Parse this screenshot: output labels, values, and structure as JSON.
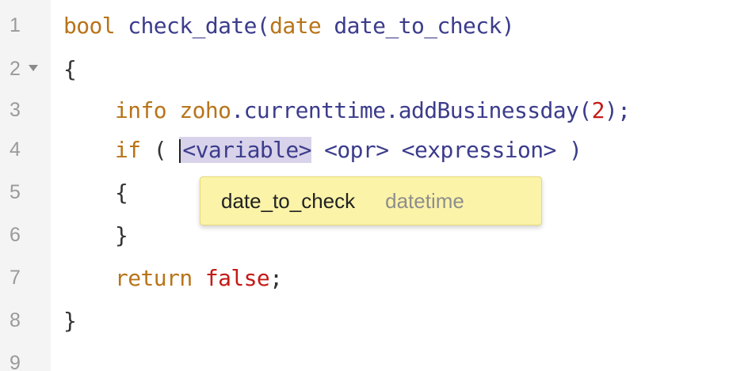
{
  "editor": {
    "lines": [
      {
        "n": "1"
      },
      {
        "n": "2"
      },
      {
        "n": "3"
      },
      {
        "n": "4"
      },
      {
        "n": "5"
      },
      {
        "n": "6"
      },
      {
        "n": "7"
      },
      {
        "n": "8"
      },
      {
        "n": "9"
      }
    ],
    "code": {
      "l1_type": "bool",
      "l1_sig": " check_date(",
      "l1_ptype": "date",
      "l1_pname": " date_to_check)",
      "l2": "{",
      "l3_indent": "    ",
      "l3_info": "info",
      "l3_obj": " zoho",
      "l3_call": ".currenttime.addBusinessday(",
      "l3_num": "2",
      "l3_end": ");",
      "l4_indent": "    ",
      "l4_if": "if",
      "l4_open": " ( ",
      "l4_var": "<variable>",
      "l4_rest": " <opr> <expression> )",
      "l5": "    {",
      "l6": "    }",
      "l7_indent": "    ",
      "l7_return": "return",
      "l7_space": " ",
      "l7_false": "false",
      "l7_semi": ";",
      "l8": "}",
      "l9": ""
    }
  },
  "suggestion": {
    "name": "date_to_check",
    "type": "datetime"
  },
  "colors": {
    "keyword": "#b8741a",
    "identifier": "#3c3c8c",
    "literal": "#c41a16",
    "placeholder_highlight": "#d8d2ea",
    "suggestion_bg": "#fbf3a8"
  },
  "icons": {
    "fold": "fold-triangle-icon"
  }
}
